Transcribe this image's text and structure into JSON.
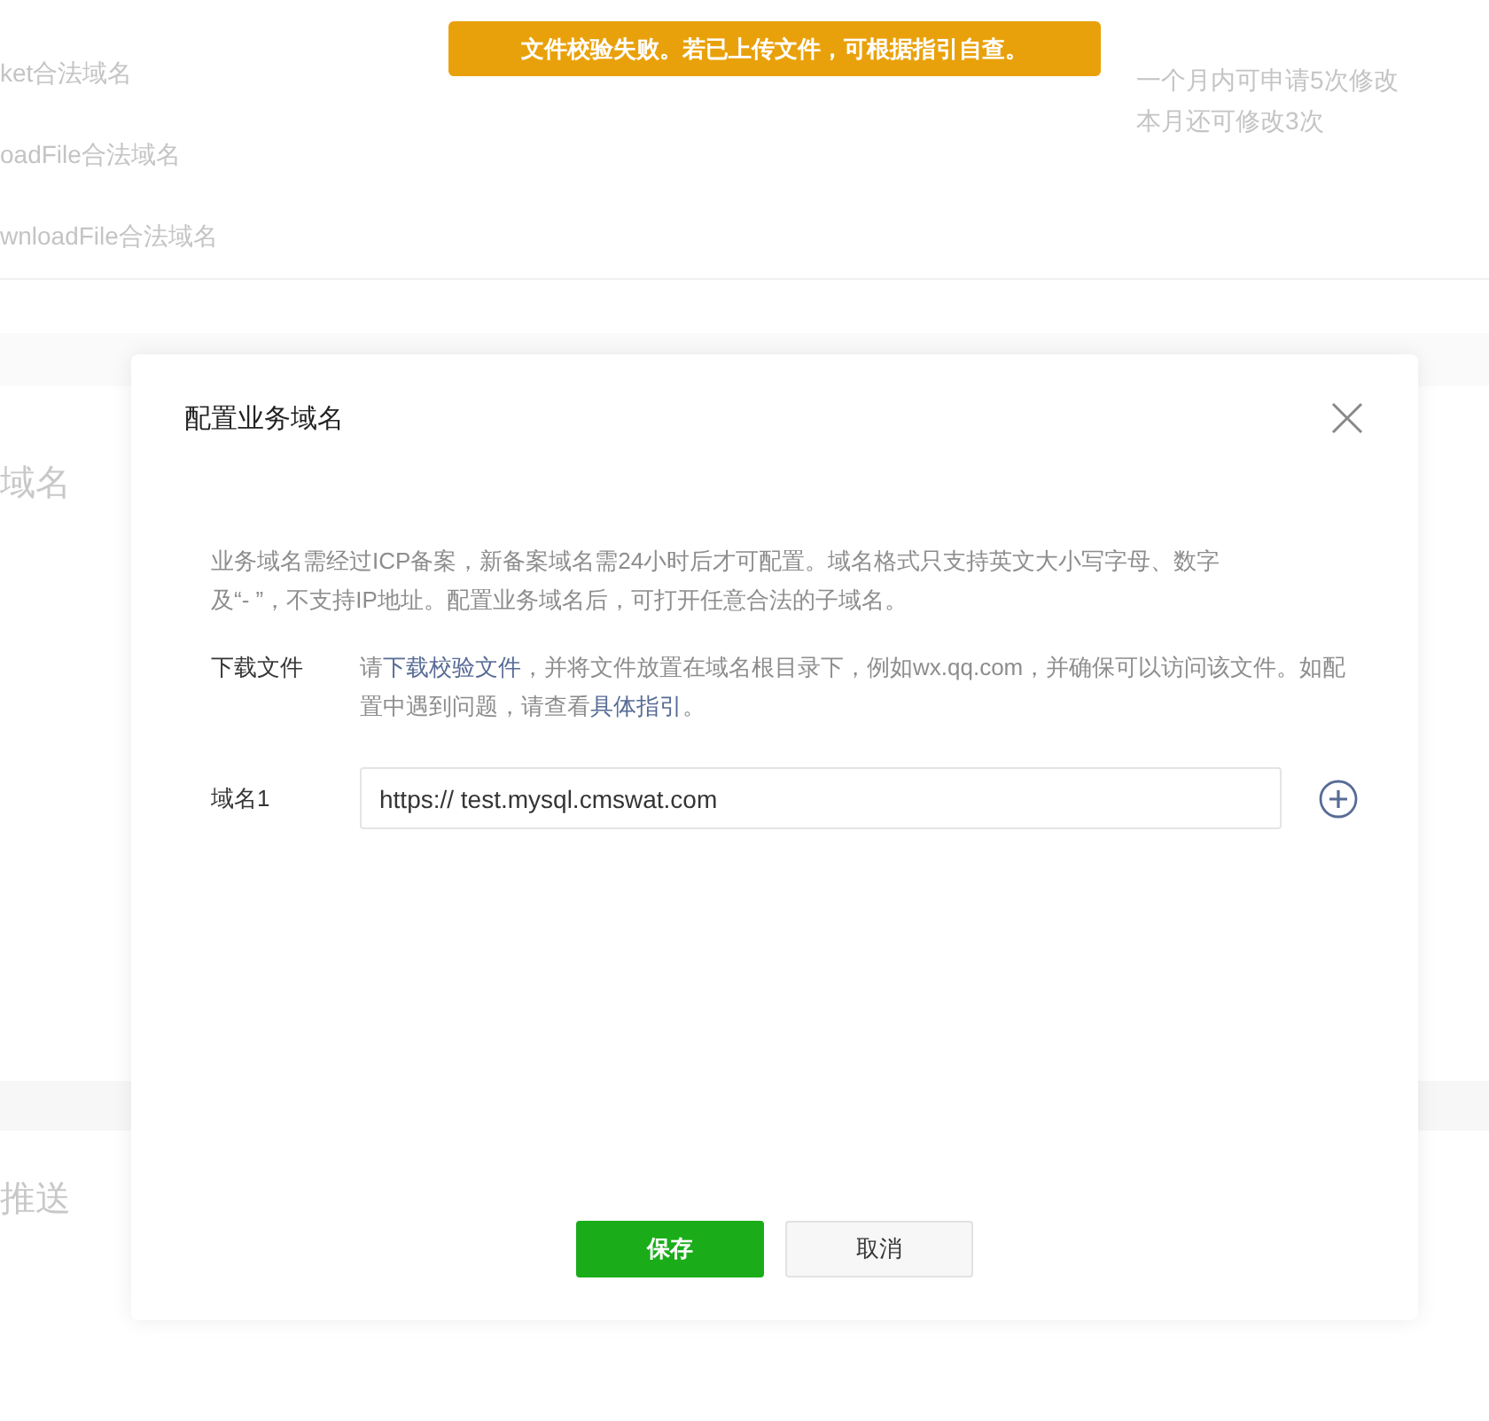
{
  "background": {
    "rows": [
      {
        "label": "ket合法域名"
      },
      {
        "label": "oadFile合法域名"
      },
      {
        "label": "wnloadFile合法域名"
      }
    ],
    "quota_notes": [
      "一个月内可申请5次修改",
      "本月还可修改3次"
    ],
    "sections": [
      {
        "title": "域名"
      },
      {
        "title": "推送"
      }
    ]
  },
  "toast": {
    "message": "文件校验失败。若已上传文件，可根据指引自查。"
  },
  "dialog": {
    "title": "配置业务域名",
    "description": "业务域名需经过ICP备案，新备案域名需24小时后才可配置。域名格式只支持英文大小写字母、数字及“- ”，不支持IP地址。配置业务域名后，可打开任意合法的子域名。",
    "download": {
      "label": "下载文件",
      "parts": [
        {
          "kind": "plain",
          "text": "请"
        },
        {
          "kind": "link",
          "text": "下载校验文件"
        },
        {
          "kind": "plain",
          "text": "，并将文件放置在域名根目录下，例如wx.qq.com，并确保可以访问该文件。如配置中遇到问题，请查看"
        },
        {
          "kind": "link",
          "text": "具体指引"
        },
        {
          "kind": "plain",
          "text": "。"
        }
      ]
    },
    "domains": [
      {
        "label": "域名1",
        "value": "https:// test.mysql.cmswat.com"
      }
    ],
    "buttons": [
      {
        "kind": "primary",
        "label": "保存"
      },
      {
        "kind": "secondary",
        "label": "取消"
      }
    ]
  }
}
